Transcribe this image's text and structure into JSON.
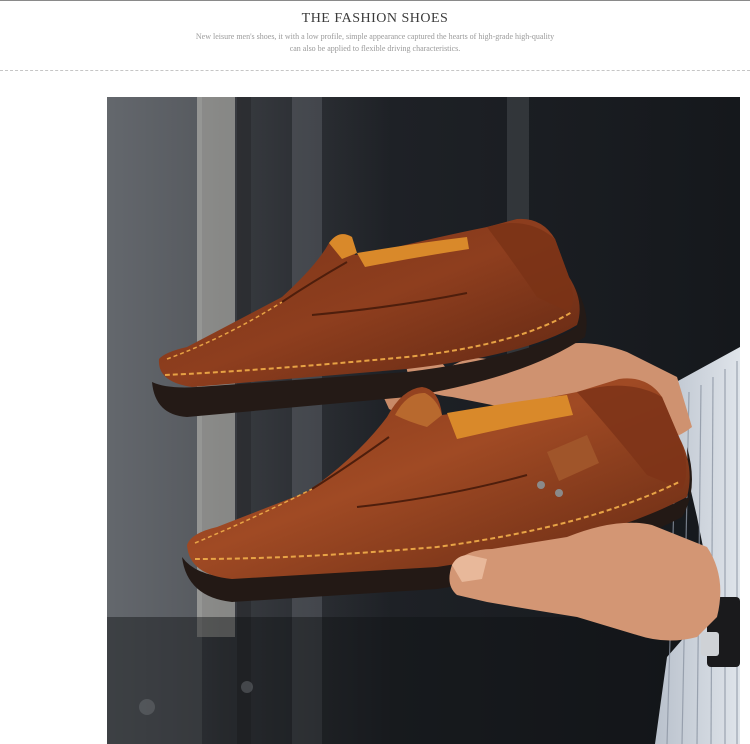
{
  "header": {
    "title": "THE FASHION SHOES",
    "description_line_1": "New leisure men's shoes, it with a low profile, simple appearance captured the hearts of high-grade high-quality",
    "description_line_2": "can also be applied to flexible driving characteristics."
  },
  "photo": {
    "subject": "two brown leather slip-on loafers with orange stitching held in hands",
    "colors": {
      "leather": "#8a3a1c",
      "leather_dark": "#5a2410",
      "leather_light": "#b0582c",
      "accent_tan": "#d98a2a",
      "stitch": "#e6a040",
      "sole": "#2a201c",
      "skin": "#d59a78",
      "background": "#1c1f24"
    }
  }
}
